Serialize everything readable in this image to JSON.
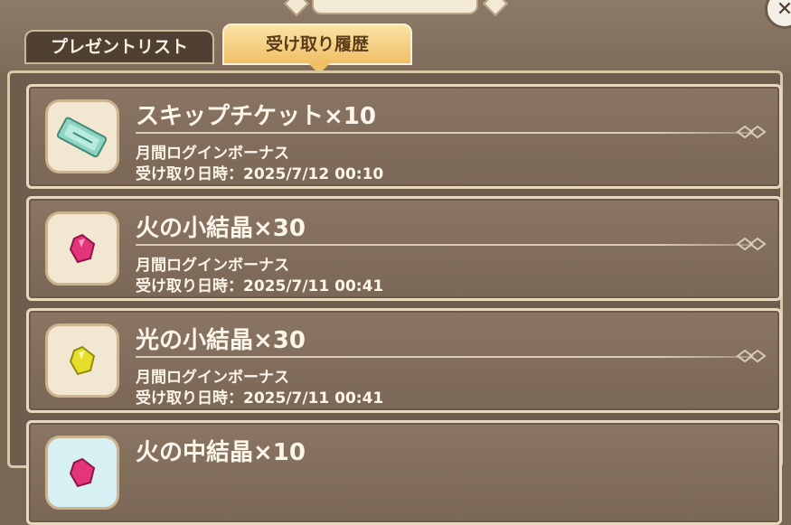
{
  "tabs": [
    {
      "label": "プレゼントリスト",
      "active": false
    },
    {
      "label": "受け取り履歴",
      "active": true
    }
  ],
  "close_icon": "close-icon",
  "date_prefix": "受け取り日時：",
  "items": [
    {
      "name": "スキップチケット×10",
      "source": "月間ログインボーナス",
      "date": "2025/7/12 00:10",
      "icon": "ticket-icon"
    },
    {
      "name": "火の小結晶×30",
      "source": "月間ログインボーナス",
      "date": "2025/7/11 00:41",
      "icon": "red-crystal-icon"
    },
    {
      "name": "光の小結晶×30",
      "source": "月間ログインボーナス",
      "date": "2025/7/11 00:41",
      "icon": "yellow-crystal-icon"
    },
    {
      "name": "火の中結晶×10",
      "source": "",
      "date": "",
      "icon": "red-crystal-icon"
    }
  ],
  "colors": {
    "active_tab": "#f0bf66",
    "card_bg": "#8a7563",
    "text": "#fbf5ea"
  }
}
